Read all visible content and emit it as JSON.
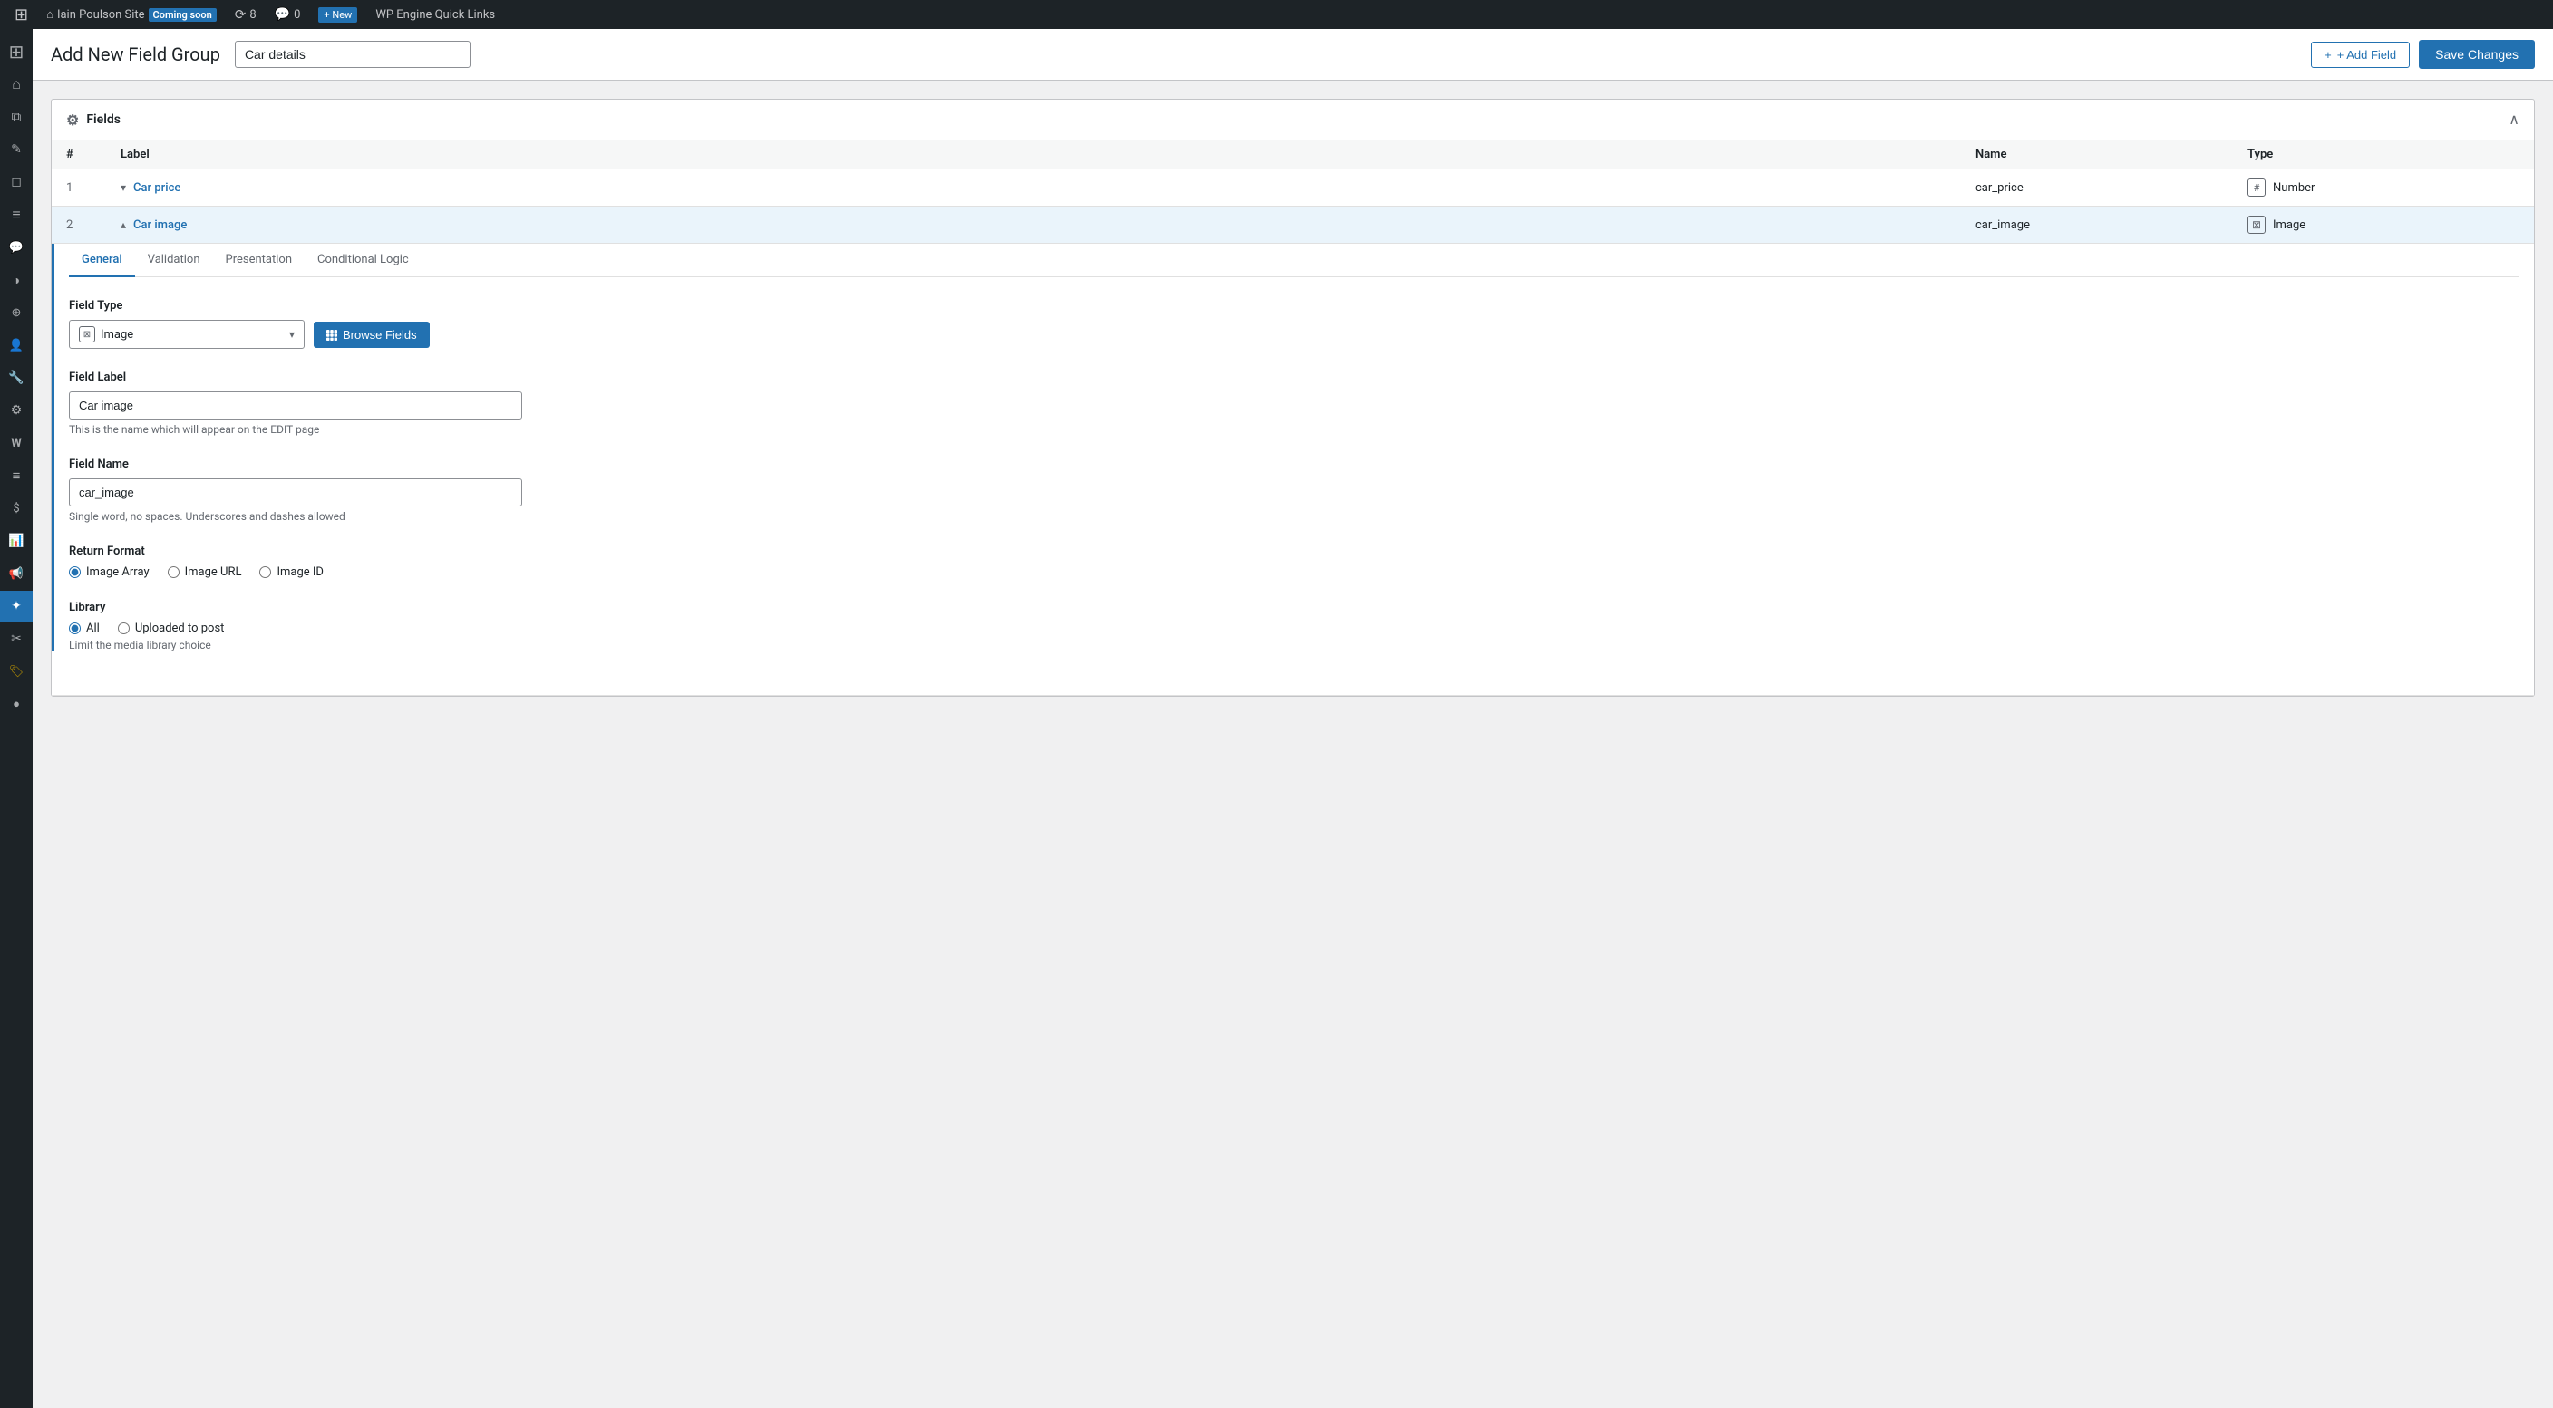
{
  "adminBar": {
    "siteName": "Iain Poulson Site",
    "badge": "Coming soon",
    "updates": "8",
    "comments": "0",
    "newLabel": "+ New",
    "wpEngine": "WP Engine Quick Links"
  },
  "pageHeader": {
    "title": "Add New Field Group",
    "groupNamePlaceholder": "Car details",
    "groupNameValue": "Car details",
    "addFieldLabel": "+ Add Field",
    "saveChangesLabel": "Save Changes"
  },
  "fieldsPanel": {
    "title": "Fields",
    "collapseLabel": "^",
    "tableHeaders": {
      "num": "#",
      "label": "Label",
      "name": "Name",
      "type": "Type"
    },
    "fields": [
      {
        "num": "1",
        "label": "Car price",
        "name": "car_price",
        "type": "Number",
        "typeIcon": "#",
        "expanded": false
      },
      {
        "num": "2",
        "label": "Car image",
        "name": "car_image",
        "type": "Image",
        "typeIcon": "⊠",
        "expanded": true
      }
    ]
  },
  "fieldDetail": {
    "tabs": [
      "General",
      "Validation",
      "Presentation",
      "Conditional Logic"
    ],
    "activeTab": "General",
    "fieldTypeLabel": "Field Type",
    "fieldTypeValue": "Image",
    "browseFieldsLabel": "Browse Fields",
    "fieldLabelLabel": "Field Label",
    "fieldLabelValue": "Car image",
    "fieldLabelHint": "This is the name which will appear on the EDIT page",
    "fieldNameLabel": "Field Name",
    "fieldNameValue": "car_image",
    "fieldNameHint": "Single word, no spaces. Underscores and dashes allowed",
    "returnFormatLabel": "Return Format",
    "returnFormatOptions": [
      {
        "value": "array",
        "label": "Image Array",
        "checked": true
      },
      {
        "value": "url",
        "label": "Image URL",
        "checked": false
      },
      {
        "value": "id",
        "label": "Image ID",
        "checked": false
      }
    ],
    "libraryLabel": "Library",
    "libraryOptions": [
      {
        "value": "all",
        "label": "All",
        "checked": true
      },
      {
        "value": "uploadedtopost",
        "label": "Uploaded to post",
        "checked": false
      }
    ],
    "libraryHint": "Limit the media library choice"
  },
  "sidebarIcons": [
    {
      "name": "wordpress-logo",
      "symbol": "⊞",
      "active": false
    },
    {
      "name": "home",
      "symbol": "⌂",
      "active": false
    },
    {
      "name": "layers",
      "symbol": "⧉",
      "active": false
    },
    {
      "name": "pencil",
      "symbol": "✎",
      "active": false
    },
    {
      "name": "media",
      "symbol": "□",
      "active": false
    },
    {
      "name": "pages",
      "symbol": "≡",
      "active": false
    },
    {
      "name": "comments",
      "symbol": "💬",
      "active": false
    },
    {
      "name": "appearance",
      "symbol": "🖌",
      "active": false
    },
    {
      "name": "plugins",
      "symbol": "🔌",
      "active": false
    },
    {
      "name": "users",
      "symbol": "👤",
      "active": false
    },
    {
      "name": "tools",
      "symbol": "🔧",
      "active": false
    },
    {
      "name": "settings",
      "symbol": "⚙",
      "active": false
    },
    {
      "name": "woocommerce",
      "symbol": "W",
      "active": false
    },
    {
      "name": "products",
      "symbol": "≡",
      "active": false
    },
    {
      "name": "orders",
      "symbol": "$",
      "active": false
    },
    {
      "name": "analytics",
      "symbol": "📊",
      "active": false
    },
    {
      "name": "marketing",
      "symbol": "📢",
      "active": false
    },
    {
      "name": "acf",
      "symbol": "✦",
      "active": true
    },
    {
      "name": "tools2",
      "symbol": "🔨",
      "active": false
    },
    {
      "name": "badge",
      "symbol": "🏷",
      "active": false
    },
    {
      "name": "extra",
      "symbol": "●",
      "active": false
    }
  ]
}
